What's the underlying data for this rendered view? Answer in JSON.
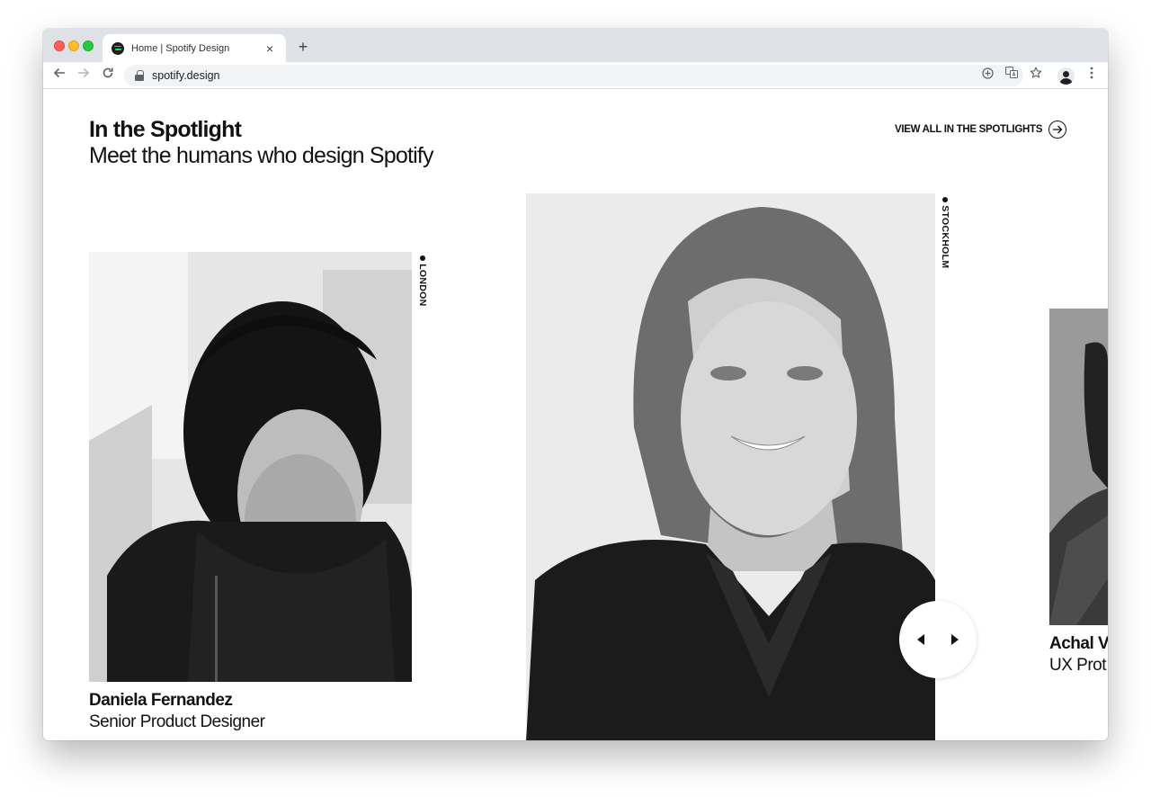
{
  "browser": {
    "tab_title": "Home | Spotify Design",
    "tab_close": "×",
    "new_tab": "+",
    "url": "spotify.design"
  },
  "section": {
    "title": "In the Spotlight",
    "subtitle": "Meet the humans who design Spotify",
    "view_all_label": "VIEW ALL IN THE SPOTLIGHTS"
  },
  "people": [
    {
      "name": "Daniela Fernandez",
      "role": "Senior Product Designer",
      "city": "LONDON"
    },
    {
      "name": "",
      "role": "",
      "city": "STOCKHOLM"
    },
    {
      "name": "Achal V",
      "role": "UX Prot",
      "city": ""
    }
  ],
  "colors": {
    "text": "#121212",
    "tab_strip": "#dee1e6",
    "omnibox": "#f1f3f4"
  }
}
